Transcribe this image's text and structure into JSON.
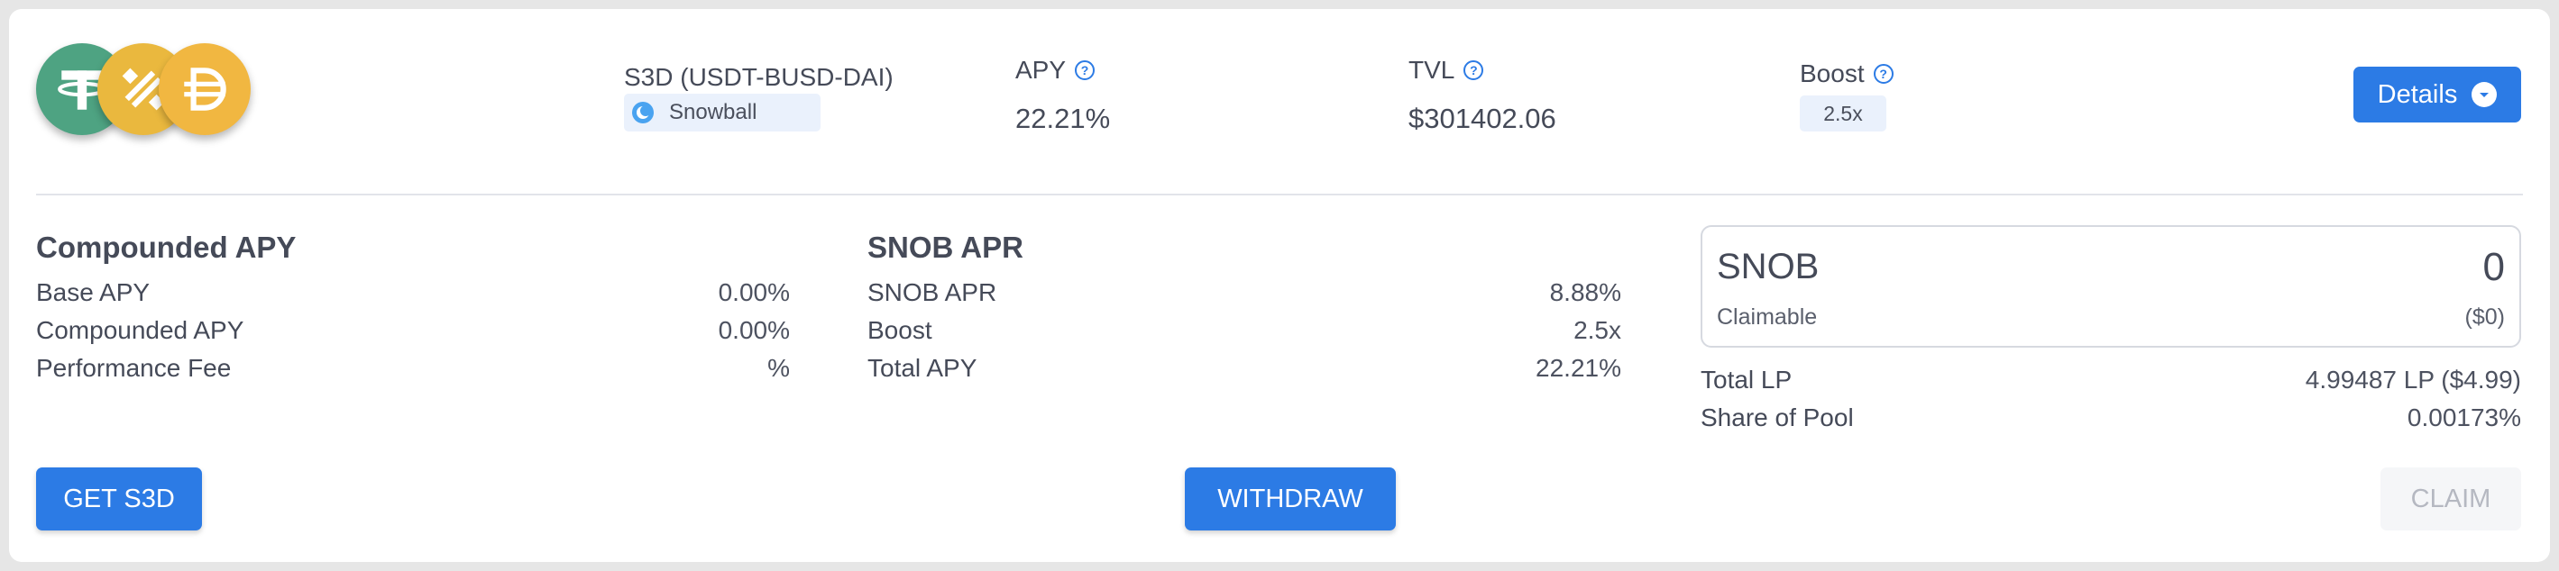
{
  "colors": {
    "accent": "#2c7be5",
    "usdt": "#4ea382",
    "busd": "#eab83e",
    "dai": "#f1b741"
  },
  "header": {
    "coins": [
      "usdt-icon",
      "busd-icon",
      "dai-icon"
    ],
    "pool_name": "S3D (USDT-BUSD-DAI)",
    "platform": "Snowball",
    "apy_label": "APY",
    "apy_value": "22.21%",
    "tvl_label": "TVL",
    "tvl_value": "$301402.06",
    "boost_label": "Boost",
    "boost_value": "2.5x",
    "details_label": "Details"
  },
  "compounded": {
    "title": "Compounded APY",
    "rows": [
      {
        "label": "Base APY",
        "value": "0.00%"
      },
      {
        "label": "Compounded APY",
        "value": "0.00%"
      },
      {
        "label": "Performance Fee",
        "value": "%"
      }
    ]
  },
  "snob_apr": {
    "title": "SNOB APR",
    "rows": [
      {
        "label": "SNOB APR",
        "value": "8.88%"
      },
      {
        "label": "Boost",
        "value": "2.5x"
      },
      {
        "label": "Total APY",
        "value": "22.21%"
      }
    ]
  },
  "claim": {
    "token": "SNOB",
    "amount": "0",
    "claimable_label": "Claimable",
    "claimable_usd": "($0)",
    "rows": [
      {
        "label": "Total LP",
        "value": "4.99487 LP ($4.99)"
      },
      {
        "label": "Share of Pool",
        "value": "0.00173%"
      }
    ]
  },
  "actions": {
    "get_label": "GET S3D",
    "withdraw_label": "WITHDRAW",
    "claim_label": "CLAIM"
  }
}
